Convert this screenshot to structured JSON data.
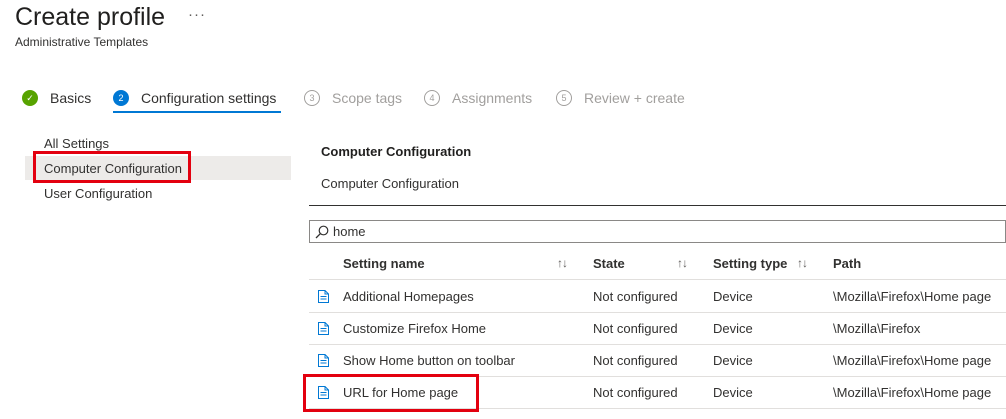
{
  "header": {
    "title": "Create profile",
    "more_label": "···",
    "subtitle": "Administrative Templates"
  },
  "wizard": {
    "steps": [
      {
        "number": "✓",
        "label": "Basics",
        "state": "done"
      },
      {
        "number": "2",
        "label": "Configuration settings",
        "state": "active"
      },
      {
        "number": "3",
        "label": "Scope tags",
        "state": "pending"
      },
      {
        "number": "4",
        "label": "Assignments",
        "state": "pending"
      },
      {
        "number": "5",
        "label": "Review + create",
        "state": "pending"
      }
    ]
  },
  "sidebar": {
    "items": [
      {
        "label": "All Settings"
      },
      {
        "label": "Computer Configuration",
        "selected": true
      },
      {
        "label": "User Configuration"
      }
    ]
  },
  "main": {
    "section_title": "Computer Configuration",
    "section_subtitle": "Computer Configuration",
    "search": {
      "value": "home",
      "placeholder": ""
    }
  },
  "table": {
    "columns": [
      {
        "label": "Setting name",
        "sort": "↑↓"
      },
      {
        "label": "State",
        "sort": "↑↓"
      },
      {
        "label": "Setting type",
        "sort": "↑↓"
      },
      {
        "label": "Path"
      }
    ],
    "rows": [
      {
        "name": "Additional Homepages",
        "state": "Not configured",
        "type": "Device",
        "path": "\\Mozilla\\Firefox\\Home page"
      },
      {
        "name": "Customize Firefox Home",
        "state": "Not configured",
        "type": "Device",
        "path": "\\Mozilla\\Firefox"
      },
      {
        "name": "Show Home button on toolbar",
        "state": "Not configured",
        "type": "Device",
        "path": "\\Mozilla\\Firefox\\Home page"
      },
      {
        "name": "URL for Home page",
        "state": "Not configured",
        "type": "Device",
        "path": "\\Mozilla\\Firefox\\Home page"
      }
    ]
  },
  "colors": {
    "accent": "#0078d4",
    "success": "#57a300",
    "highlight_box": "#e3000f",
    "selected_bg": "#edebe9"
  }
}
